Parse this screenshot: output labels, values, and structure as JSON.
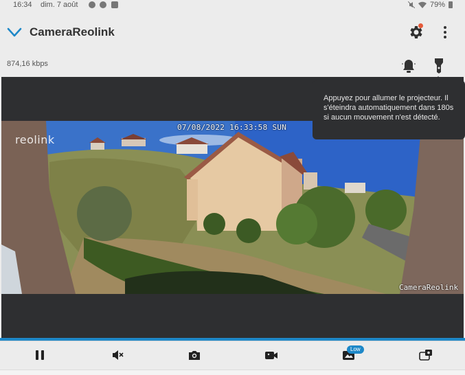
{
  "status_bar": {
    "time": "16:34",
    "date": "dim. 7 août",
    "battery": "79%"
  },
  "header": {
    "title": "CameraReolink",
    "icons": [
      "chevron-down-icon",
      "gear-icon",
      "more-vertical-icon"
    ]
  },
  "stream": {
    "bitrate": "874,16 kbps",
    "osd_timestamp": "07/08/2022 16:33:58 SUN",
    "osd_camera_name": "CameraReolink",
    "logo": "reolink"
  },
  "spotlight_tooltip": {
    "text": "Appuyez pour allumer le projecteur. Il s'éteindra automatiquement dans 180s si aucun mouvement n'est détecté."
  },
  "toolbar": {
    "quality_badge": "Low",
    "buttons": [
      "pause-icon",
      "mute-icon",
      "snapshot-icon",
      "record-icon",
      "quality-icon",
      "multiview-icon"
    ]
  },
  "colors": {
    "accent": "#1e88c8",
    "notification_dot": "#e55a3a",
    "video_panel": "#2e2f31"
  }
}
